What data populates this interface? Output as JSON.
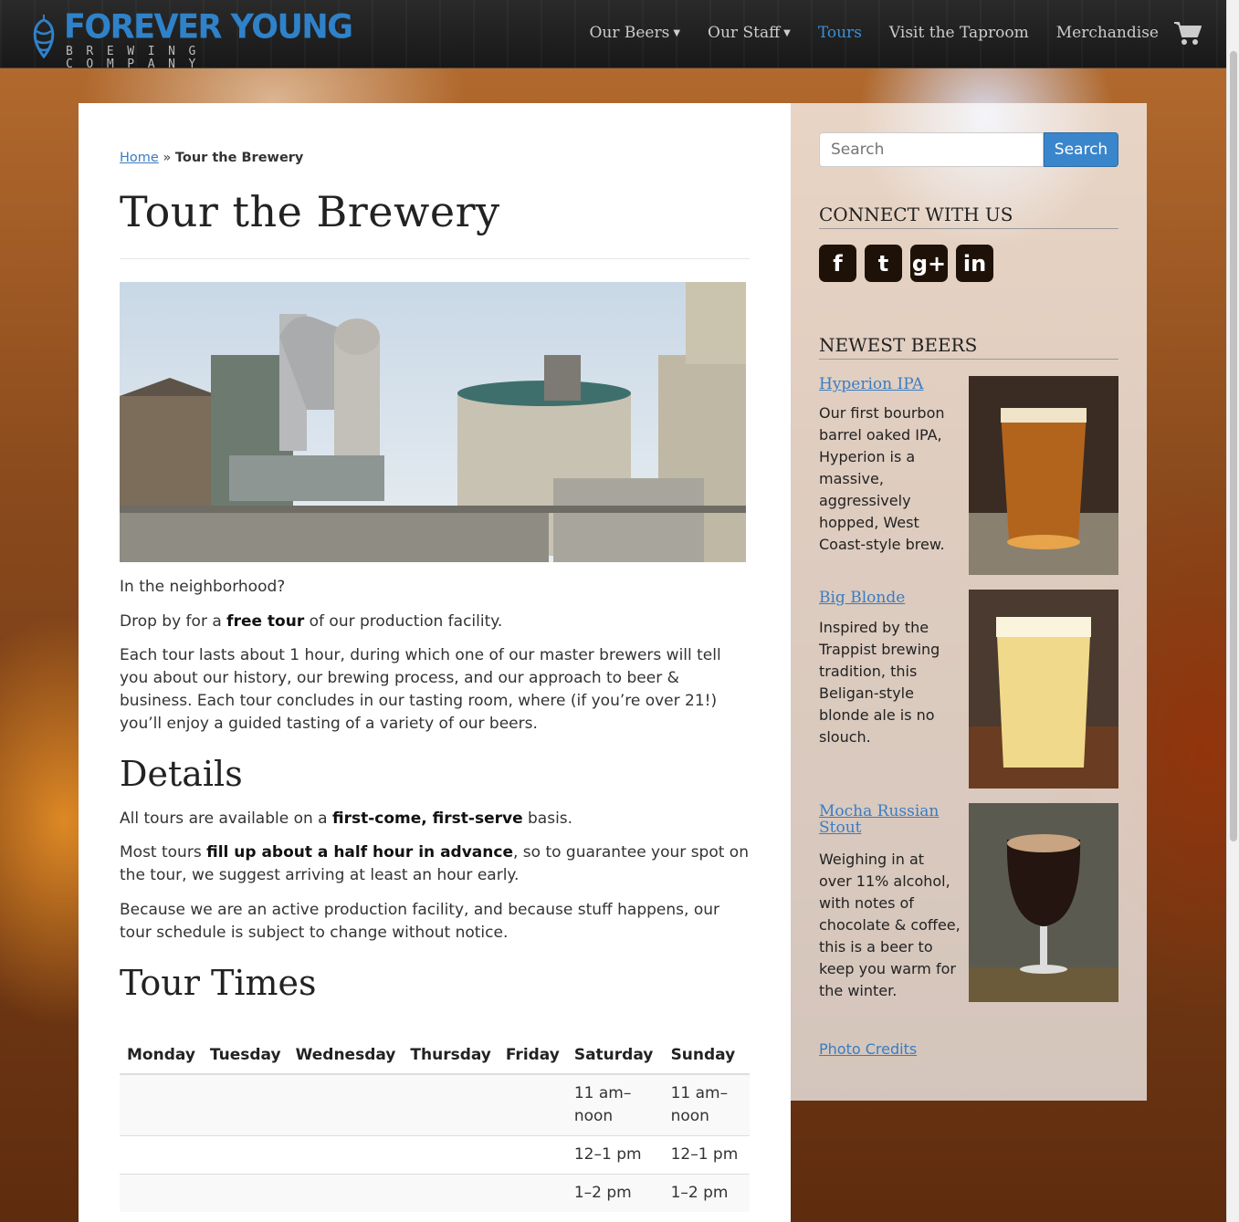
{
  "brand": {
    "name": "FOREVER YOUNG",
    "sub": "BREWING COMPANY",
    "color": "#2f82c9"
  },
  "nav": {
    "items": [
      {
        "label": "Our Beers",
        "dropdown": true
      },
      {
        "label": "Our Staff",
        "dropdown": true
      },
      {
        "label": "Tours",
        "active": true
      },
      {
        "label": "Visit the Taproom"
      },
      {
        "label": "Merchandise"
      }
    ],
    "cart_icon": "shopping-cart-icon"
  },
  "breadcrumb": {
    "home": "Home",
    "separator": "»",
    "current": "Tour the Brewery"
  },
  "page": {
    "title": "Tour the Brewery",
    "intro": "In the neighborhood?",
    "p1_pre": "Drop by for a ",
    "p1_bold": "free tour",
    "p1_post": " of our production facility.",
    "p2": "Each tour lasts about 1 hour, during which one of our master brewers will tell you about our history, our brewing process, and our approach to beer & business. Each tour concludes in our tasting room, where (if you’re over 21!) you’ll enjoy a guided tasting of a variety of our beers.",
    "details_heading": "Details",
    "d1_pre": "All tours are available on a ",
    "d1_bold": "first-come, first-serve",
    "d1_post": " basis.",
    "d2_pre": "Most tours ",
    "d2_bold": "fill up about a half hour in advance",
    "d2_post": ", so to guarantee your spot on the tour, we suggest arriving at least an hour early.",
    "d3": "Because we are an active production facility, and because stuff happens, our tour schedule is subject to change without notice.",
    "times_heading": "Tour Times"
  },
  "tour_times": {
    "columns": [
      "Monday",
      "Tuesday",
      "Wednesday",
      "Thursday",
      "Friday",
      "Saturday",
      "Sunday"
    ],
    "rows": [
      [
        "",
        "",
        "",
        "",
        "",
        "11 am–noon",
        "11 am–noon"
      ],
      [
        "",
        "",
        "",
        "",
        "",
        "12–1 pm",
        "12–1 pm"
      ],
      [
        "",
        "",
        "",
        "",
        "",
        "1–2 pm",
        "1–2 pm"
      ]
    ]
  },
  "sidebar": {
    "search_placeholder": "Search",
    "search_button": "Search",
    "connect_heading": "CONNECT WITH US",
    "social": [
      {
        "icon": "facebook-icon",
        "glyph": "f"
      },
      {
        "icon": "twitter-icon",
        "glyph": "t"
      },
      {
        "icon": "google-plus-icon",
        "glyph": "g+"
      },
      {
        "icon": "linkedin-icon",
        "glyph": "in"
      }
    ],
    "newest_heading": "NEWEST BEERS",
    "beers": [
      {
        "name": "Hyperion IPA",
        "desc": "Our first bourbon barrel oaked IPA, Hyperion is a massive, aggressively hopped, West Coast-style brew."
      },
      {
        "name": "Big Blonde",
        "desc": "Inspired by the Trappist brewing tradition, this Beligan-style blonde ale is no slouch."
      },
      {
        "name": "Mocha Russian Stout",
        "desc": "Weighing in at over 11% alcohol, with notes of chocolate & coffee, this is a beer to keep you warm for the winter."
      }
    ],
    "credits": "Photo Credits"
  }
}
